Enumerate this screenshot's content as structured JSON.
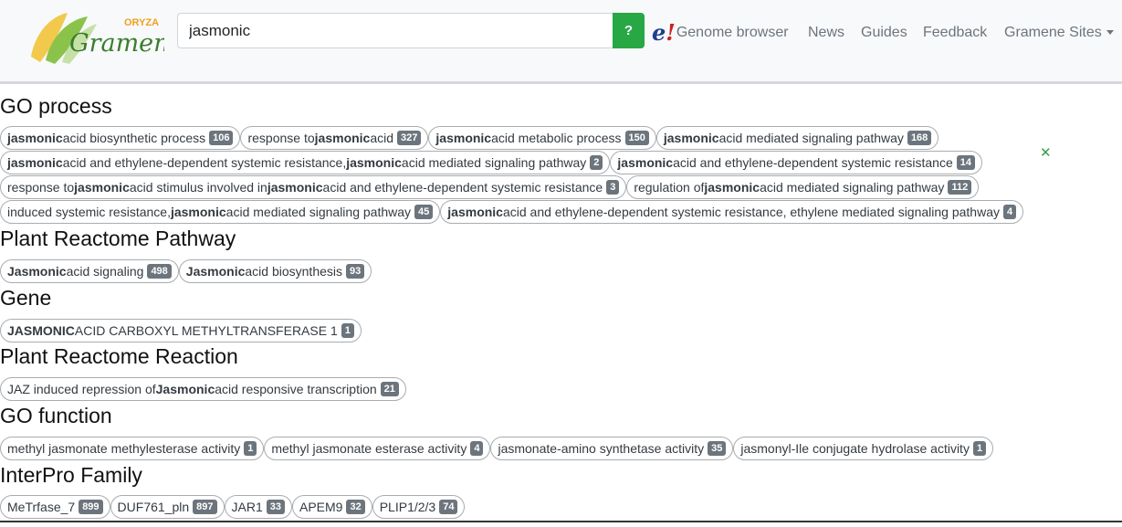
{
  "header": {
    "logo": {
      "small_text": "ORYZA",
      "main_text": "Gramene"
    },
    "search": {
      "value": "jasmonic",
      "button_label": "?"
    },
    "nav": {
      "ensembl_icon_text": "e",
      "ensembl_icon_bang": "!",
      "genome_browser": "Genome browser",
      "news": "News",
      "guides": "Guides",
      "feedback": "Feedback",
      "sites": "Gramene Sites"
    }
  },
  "sections": {
    "go_process": {
      "title": "GO process",
      "items": [
        {
          "parts": [
            {
              "b": "jasmonic"
            },
            {
              "t": " acid biosynthetic process"
            }
          ],
          "count": "106"
        },
        {
          "parts": [
            {
              "t": "response to "
            },
            {
              "b": "jasmonic"
            },
            {
              "t": " acid"
            }
          ],
          "count": "327"
        },
        {
          "parts": [
            {
              "b": "jasmonic"
            },
            {
              "t": " acid metabolic process"
            }
          ],
          "count": "150"
        },
        {
          "parts": [
            {
              "b": "jasmonic"
            },
            {
              "t": " acid mediated signaling pathway"
            }
          ],
          "count": "168"
        },
        {
          "parts": [
            {
              "b": "jasmonic"
            },
            {
              "t": " acid and ethylene-dependent systemic resistance, "
            },
            {
              "b": "jasmonic"
            },
            {
              "t": " acid mediated signaling pathway"
            }
          ],
          "count": "2"
        },
        {
          "parts": [
            {
              "b": "jasmonic"
            },
            {
              "t": " acid and ethylene-dependent systemic resistance"
            }
          ],
          "count": "14"
        },
        {
          "parts": [
            {
              "t": "response to "
            },
            {
              "b": "jasmonic"
            },
            {
              "t": " acid stimulus involved in "
            },
            {
              "b": "jasmonic"
            },
            {
              "t": " acid and ethylene-dependent systemic resistance"
            }
          ],
          "count": "3"
        },
        {
          "parts": [
            {
              "t": "regulation of "
            },
            {
              "b": "jasmonic"
            },
            {
              "t": " acid mediated signaling pathway"
            }
          ],
          "count": "112"
        },
        {
          "parts": [
            {
              "t": "induced systemic resistance, "
            },
            {
              "b": "jasmonic"
            },
            {
              "t": " acid mediated signaling pathway"
            }
          ],
          "count": "45"
        },
        {
          "parts": [
            {
              "b": "jasmonic"
            },
            {
              "t": " acid and ethylene-dependent systemic resistance, ethylene mediated signaling pathway"
            }
          ],
          "count": "4"
        }
      ]
    },
    "plant_reactome_pathway": {
      "title": "Plant Reactome Pathway",
      "items": [
        {
          "parts": [
            {
              "b": "Jasmonic"
            },
            {
              "t": " acid signaling"
            }
          ],
          "count": "498"
        },
        {
          "parts": [
            {
              "b": "Jasmonic"
            },
            {
              "t": " acid biosynthesis"
            }
          ],
          "count": "93"
        }
      ]
    },
    "gene": {
      "title": "Gene",
      "items": [
        {
          "parts": [
            {
              "b": "JASMONIC"
            },
            {
              "t": " ACID CARBOXYL METHYLTRANSFERASE 1"
            }
          ],
          "count": "1"
        }
      ]
    },
    "plant_reactome_reaction": {
      "title": "Plant Reactome Reaction",
      "items": [
        {
          "parts": [
            {
              "t": "JAZ induced repression of "
            },
            {
              "b": "Jasmonic"
            },
            {
              "t": " acid responsive transcription"
            }
          ],
          "count": "21"
        }
      ]
    },
    "go_function": {
      "title": "GO function",
      "items": [
        {
          "parts": [
            {
              "t": "methyl jasmonate methylesterase activity"
            }
          ],
          "count": "1"
        },
        {
          "parts": [
            {
              "t": "methyl jasmonate esterase activity"
            }
          ],
          "count": "4"
        },
        {
          "parts": [
            {
              "t": "jasmonate-amino synthetase activity"
            }
          ],
          "count": "35"
        },
        {
          "parts": [
            {
              "t": "jasmonyl-Ile conjugate hydrolase activity"
            }
          ],
          "count": "1"
        }
      ]
    },
    "interpro_family": {
      "title": "InterPro Family",
      "items": [
        {
          "parts": [
            {
              "t": "MeTrfase_7"
            }
          ],
          "count": "899"
        },
        {
          "parts": [
            {
              "t": "DUF761_pln"
            }
          ],
          "count": "897"
        },
        {
          "parts": [
            {
              "t": "JAR1"
            }
          ],
          "count": "33"
        },
        {
          "parts": [
            {
              "t": "APEM9"
            }
          ],
          "count": "32"
        },
        {
          "parts": [
            {
              "t": "PLIP1/2/3"
            }
          ],
          "count": "74"
        }
      ]
    }
  },
  "close_icon_glyph": "✕",
  "colors": {
    "search_button": "#28a745",
    "badge": "#6c757d",
    "ensembl_blue": "#1f3e8f",
    "ensembl_red": "#cc2222",
    "logo_green": "#7cb342",
    "logo_yellow": "#f2c94c"
  }
}
